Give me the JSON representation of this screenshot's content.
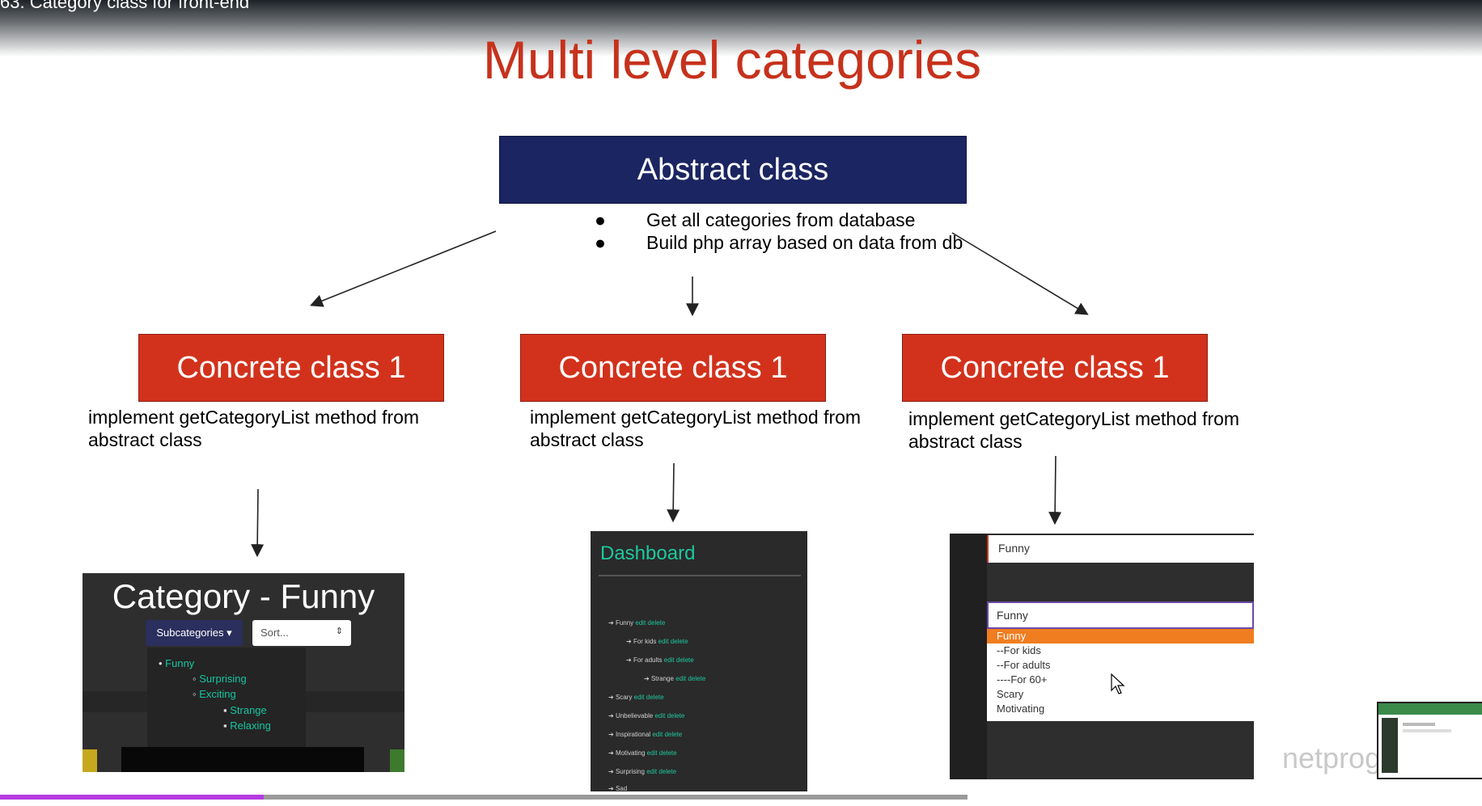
{
  "video": {
    "title": "63. Category class for front-end"
  },
  "slide": {
    "title": "Multi level categories",
    "abstract_box": "Abstract class",
    "bullets": [
      "Get all categories from database",
      "Build php array based on data from db"
    ],
    "bullet_symbol": "●",
    "concrete": [
      {
        "label": "Concrete class 1",
        "desc": "implement getCategoryList method from abstract class"
      },
      {
        "label": "Concrete class 1",
        "desc": "implement getCategoryList method from abstract class"
      },
      {
        "label": "Concrete class 1",
        "desc": "implement getCategoryList method from abstract class"
      }
    ]
  },
  "screenshot1": {
    "title": "Category - Funny",
    "dropdown": "Subcategories ▾",
    "sort": "Sort...",
    "tree": [
      "Funny",
      "Surprising",
      "Exciting",
      "Strange",
      "Relaxing"
    ]
  },
  "screenshot2": {
    "title": "Dashboard",
    "edit": "edit",
    "delete": "delete",
    "items": [
      "Funny",
      "For kids",
      "For adults",
      "Strange",
      "Scary",
      "Unbelievable",
      "Inspirational",
      "Motivating",
      "Surprising",
      "Sad"
    ]
  },
  "screenshot3": {
    "input1": "Funny",
    "input2": "Funny",
    "options": [
      "Funny",
      "--For kids",
      "--For adults",
      "----For 60+",
      "Scary",
      "Motivating"
    ]
  },
  "watermark": "netprog",
  "colors": {
    "title": "#c6321c",
    "abstract": "#1a2561",
    "concrete": "#d2321c",
    "accent_green": "#1ec89e",
    "progress": "#b53be0"
  }
}
